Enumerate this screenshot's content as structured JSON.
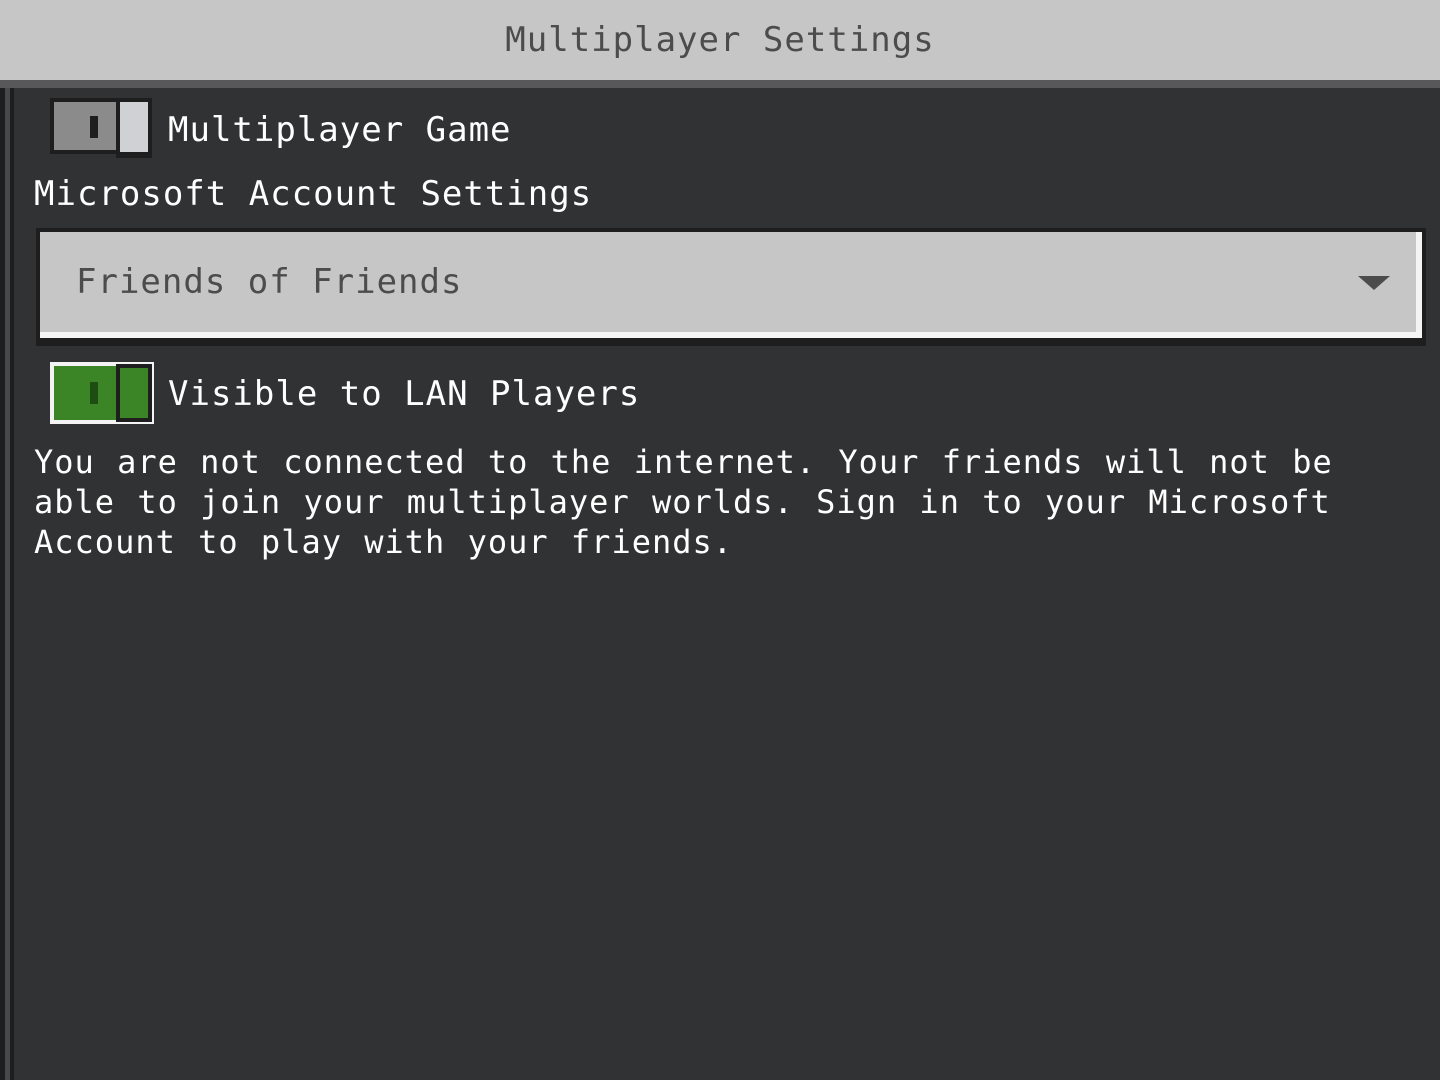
{
  "header": {
    "title": "Multiplayer Settings"
  },
  "settings": {
    "multiplayer_game": {
      "label": "Multiplayer Game",
      "enabled": false
    },
    "account_section_label": "Microsoft Account Settings",
    "account_dropdown": {
      "selected": "Friends of Friends"
    },
    "visible_to_lan": {
      "label": "Visible to LAN Players",
      "enabled": true
    },
    "notice": "You are not connected to the internet. Your friends will not be able to join your multiplayer worlds. Sign in to your Microsoft Account to play with your friends."
  },
  "colors": {
    "header_bg": "#c6c6c6",
    "panel_bg": "#313233",
    "toggle_on": "#3c8527",
    "toggle_off": "#8b8b8b",
    "text": "#ffffff"
  }
}
